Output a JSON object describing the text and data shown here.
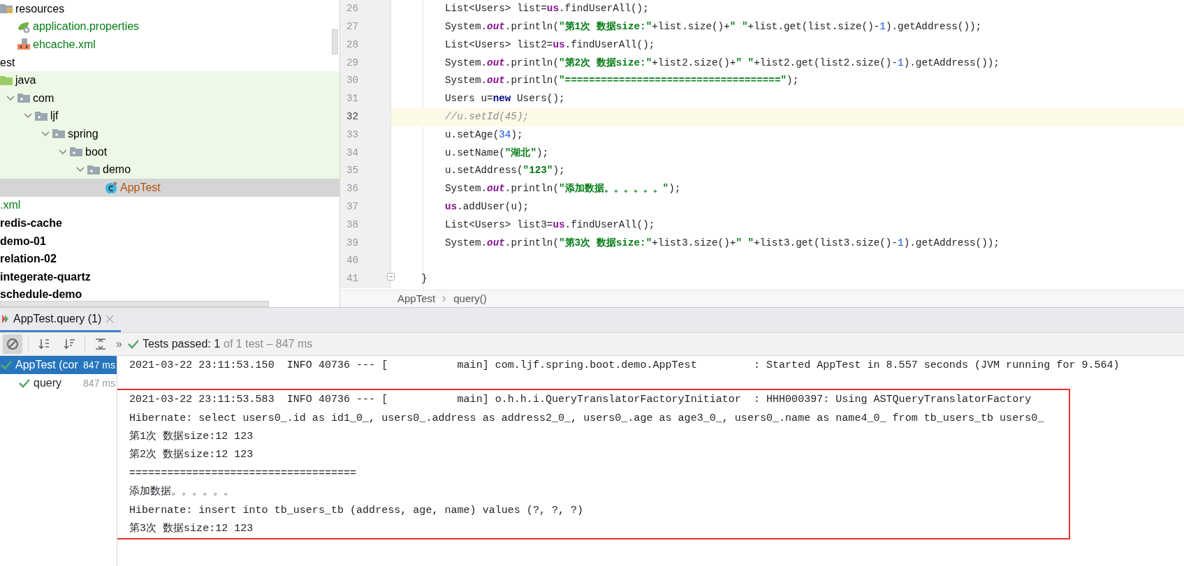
{
  "project_tree": [
    {
      "label": "resources",
      "kind": "resources",
      "color": "#000000",
      "selected": false,
      "tinted": false,
      "children": [
        {
          "label": "application.properties",
          "kind": "spring",
          "color": "#067d17",
          "selected": false,
          "tinted": false
        },
        {
          "label": "ehcache.xml",
          "kind": "xml",
          "color": "#067d17",
          "selected": false,
          "tinted": false
        }
      ]
    },
    {
      "label": "est",
      "kind": "plain",
      "color": "#000000",
      "selected": false,
      "tinted": false,
      "children": [
        {
          "label": "java",
          "kind": "test-root",
          "color": "#000000",
          "selected": false,
          "tinted": true,
          "children": [
            {
              "label": "com",
              "kind": "package",
              "color": "#000000",
              "selected": false,
              "tinted": true,
              "expanded": true,
              "children": [
                {
                  "label": "ljf",
                  "kind": "package",
                  "color": "#000000",
                  "selected": false,
                  "tinted": true,
                  "expanded": true,
                  "children": [
                    {
                      "label": "spring",
                      "kind": "package",
                      "color": "#000000",
                      "selected": false,
                      "tinted": true,
                      "expanded": true,
                      "children": [
                        {
                          "label": "boot",
                          "kind": "package",
                          "color": "#000000",
                          "selected": false,
                          "tinted": true,
                          "expanded": true,
                          "children": [
                            {
                              "label": "demo",
                              "kind": "package",
                              "color": "#000000",
                              "selected": false,
                              "tinted": true,
                              "expanded": true,
                              "children": [
                                {
                                  "label": "AppTest",
                                  "kind": "class",
                                  "color": "#b1520f",
                                  "selected": true,
                                  "tinted": false
                                }
                              ]
                            }
                          ]
                        }
                      ]
                    }
                  ]
                }
              ]
            }
          ]
        }
      ]
    },
    {
      "label": ".xml",
      "kind": "plain",
      "color": "#067d17",
      "selected": false,
      "tinted": false
    },
    {
      "label": "redis-cache",
      "kind": "module",
      "color": "#000000",
      "selected": false,
      "tinted": false
    },
    {
      "label": "demo-01",
      "kind": "module",
      "color": "#000000",
      "selected": false,
      "tinted": false
    },
    {
      "label": "relation-02",
      "kind": "module",
      "color": "#000000",
      "selected": false,
      "tinted": false
    },
    {
      "label": "integerate-quartz",
      "kind": "module",
      "color": "#000000",
      "selected": false,
      "tinted": false
    },
    {
      "label": "schedule-demo",
      "kind": "module",
      "color": "#000000",
      "selected": false,
      "tinted": false
    }
  ],
  "editor": {
    "lines": [
      {
        "number": "26",
        "caret_line": false,
        "tokens": [
          {
            "text": "List<Users> list=",
            "kind": "plain"
          },
          {
            "text": "us",
            "kind": "field"
          },
          {
            "text": ".findUserAll();",
            "kind": "plain"
          }
        ]
      },
      {
        "number": "27",
        "caret_line": false,
        "tokens": [
          {
            "text": "System.",
            "kind": "plain"
          },
          {
            "text": "out",
            "kind": "static_field"
          },
          {
            "text": ".println(",
            "kind": "plain"
          },
          {
            "text": "\"第1次 数据size:\"",
            "kind": "string"
          },
          {
            "text": "+list.size()+",
            "kind": "plain"
          },
          {
            "text": "\" \"",
            "kind": "string"
          },
          {
            "text": "+list.get(list.size()-",
            "kind": "plain"
          },
          {
            "text": "1",
            "kind": "number"
          },
          {
            "text": ").getAddress());",
            "kind": "plain"
          }
        ]
      },
      {
        "number": "28",
        "caret_line": false,
        "tokens": [
          {
            "text": "List<Users> list2=",
            "kind": "plain"
          },
          {
            "text": "us",
            "kind": "field"
          },
          {
            "text": ".findUserAll();",
            "kind": "plain"
          }
        ]
      },
      {
        "number": "29",
        "caret_line": false,
        "tokens": [
          {
            "text": "System.",
            "kind": "plain"
          },
          {
            "text": "out",
            "kind": "static_field"
          },
          {
            "text": ".println(",
            "kind": "plain"
          },
          {
            "text": "\"第2次 数据size:\"",
            "kind": "string"
          },
          {
            "text": "+list2.size()+",
            "kind": "plain"
          },
          {
            "text": "\" \"",
            "kind": "string"
          },
          {
            "text": "+list2.get(list2.size()-",
            "kind": "plain"
          },
          {
            "text": "1",
            "kind": "number"
          },
          {
            "text": ").getAddress());",
            "kind": "plain"
          }
        ]
      },
      {
        "number": "30",
        "caret_line": false,
        "tokens": [
          {
            "text": "System.",
            "kind": "plain"
          },
          {
            "text": "out",
            "kind": "static_field"
          },
          {
            "text": ".println(",
            "kind": "plain"
          },
          {
            "text": "\"====================================\"",
            "kind": "string"
          },
          {
            "text": ");",
            "kind": "plain"
          }
        ]
      },
      {
        "number": "31",
        "caret_line": false,
        "tokens": [
          {
            "text": "Users u=",
            "kind": "plain"
          },
          {
            "text": "new",
            "kind": "keyword"
          },
          {
            "text": " Users();",
            "kind": "plain"
          }
        ]
      },
      {
        "number": "32",
        "caret_line": true,
        "tokens": [
          {
            "text": "//u.setId(45);",
            "kind": "comment"
          }
        ]
      },
      {
        "number": "33",
        "caret_line": false,
        "tokens": [
          {
            "text": "u.setAge(",
            "kind": "plain"
          },
          {
            "text": "34",
            "kind": "number"
          },
          {
            "text": ");",
            "kind": "plain"
          }
        ]
      },
      {
        "number": "34",
        "caret_line": false,
        "tokens": [
          {
            "text": "u.setName(",
            "kind": "plain"
          },
          {
            "text": "\"湖北\"",
            "kind": "string"
          },
          {
            "text": ");",
            "kind": "plain"
          }
        ]
      },
      {
        "number": "35",
        "caret_line": false,
        "tokens": [
          {
            "text": "u.setAddress(",
            "kind": "plain"
          },
          {
            "text": "\"123\"",
            "kind": "string"
          },
          {
            "text": ");",
            "kind": "plain"
          }
        ]
      },
      {
        "number": "36",
        "caret_line": false,
        "tokens": [
          {
            "text": "System.",
            "kind": "plain"
          },
          {
            "text": "out",
            "kind": "static_field"
          },
          {
            "text": ".println(",
            "kind": "plain"
          },
          {
            "text": "\"添加数据。。。。。。\"",
            "kind": "string"
          },
          {
            "text": ");",
            "kind": "plain"
          }
        ]
      },
      {
        "number": "37",
        "caret_line": false,
        "tokens": [
          {
            "text": "us",
            "kind": "field"
          },
          {
            "text": ".addUser(u);",
            "kind": "plain"
          }
        ]
      },
      {
        "number": "38",
        "caret_line": false,
        "tokens": [
          {
            "text": "List<Users> list3=",
            "kind": "plain"
          },
          {
            "text": "us",
            "kind": "field"
          },
          {
            "text": ".findUserAll();",
            "kind": "plain"
          }
        ]
      },
      {
        "number": "39",
        "caret_line": false,
        "tokens": [
          {
            "text": "System.",
            "kind": "plain"
          },
          {
            "text": "out",
            "kind": "static_field"
          },
          {
            "text": ".println(",
            "kind": "plain"
          },
          {
            "text": "\"第3次 数据size:\"",
            "kind": "string"
          },
          {
            "text": "+list3.size()+",
            "kind": "plain"
          },
          {
            "text": "\" \"",
            "kind": "string"
          },
          {
            "text": "+list3.get(list3.size()-",
            "kind": "plain"
          },
          {
            "text": "1",
            "kind": "number"
          },
          {
            "text": ").getAddress());",
            "kind": "plain"
          }
        ]
      },
      {
        "number": "40",
        "caret_line": false
      },
      {
        "number": "41",
        "caret_line": false,
        "fold": true,
        "kind": "block_end",
        "tokens": [
          {
            "text": "}",
            "kind": "plain"
          }
        ]
      }
    ],
    "breadcrumbs": [
      "AppTest",
      "query()"
    ]
  },
  "run_tab": {
    "label": "AppTest.query (1)",
    "selected": true
  },
  "toolbar": {
    "buttons": [
      {
        "kind": "show-passed",
        "pressed": true
      },
      {
        "kind": "sort-alpha",
        "pressed": false
      },
      {
        "kind": "sort-duration",
        "pressed": false
      },
      {
        "kind": "expand-all",
        "pressed": false
      }
    ],
    "overflow": "»",
    "status": "Tests passed: 1",
    "detail": "of 1 test – 847 ms",
    "passed": true
  },
  "test_tree": [
    {
      "label": "AppTest (cor",
      "time": "847 ms",
      "passed": true,
      "selected": true,
      "children": [
        {
          "label": "query",
          "time": "847 ms",
          "passed": true,
          "selected": false
        }
      ]
    }
  ],
  "console": [
    {
      "text": "2021-03-22 23:11:53.150  INFO 40736 --- [           main] com.ljf.spring.boot.demo.AppTest         : Started AppTest in 8.557 seconds (JVM running for 9.564)",
      "boxed": false
    },
    {
      "text": "2021-03-22 23:11:53.583  INFO 40736 --- [           main] o.h.h.i.QueryTranslatorFactoryInitiator  : HHH000397: Using ASTQueryTranslatorFactory",
      "boxed": true
    },
    {
      "text": "Hibernate: select users0_.id as id1_0_, users0_.address as address2_0_, users0_.age as age3_0_, users0_.name as name4_0_ from tb_users_tb users0_",
      "boxed": true
    },
    {
      "text": "第1次 数据size:12 123",
      "boxed": true
    },
    {
      "text": "第2次 数据size:12 123",
      "boxed": true
    },
    {
      "text": "====================================",
      "boxed": true
    },
    {
      "text": "添加数据。。。。。。",
      "boxed": true
    },
    {
      "text": "Hibernate: insert into tb_users_tb (address, age, name) values (?, ?, ?)",
      "boxed": true
    },
    {
      "text": "第3次 数据size:12 123",
      "boxed": true
    }
  ]
}
